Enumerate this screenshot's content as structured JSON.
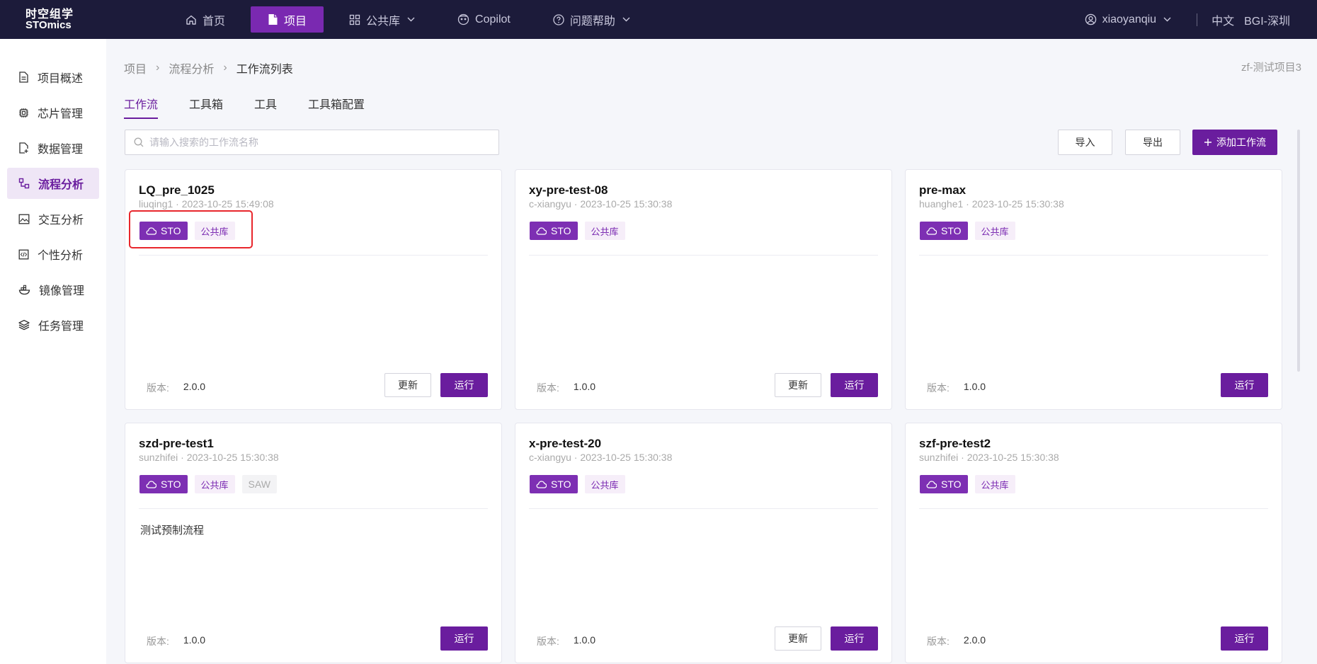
{
  "brand": {
    "line1": "时空组学",
    "line2": "STOmics"
  },
  "nav": [
    {
      "label": "首页",
      "icon": "home-icon",
      "active": false,
      "chevron": false
    },
    {
      "label": "项目",
      "icon": "file-icon",
      "active": true,
      "chevron": false
    },
    {
      "label": "公共库",
      "icon": "grid-icon",
      "active": false,
      "chevron": true
    },
    {
      "label": "Copilot",
      "icon": "copilot-icon",
      "active": false,
      "chevron": false
    },
    {
      "label": "问题帮助",
      "icon": "help-icon",
      "active": false,
      "chevron": true
    }
  ],
  "user": {
    "name": "xiaoyanqiu",
    "lang": "中文",
    "org": "BGI-深圳"
  },
  "sidebar": [
    {
      "label": "项目概述",
      "icon": "document-icon",
      "active": false
    },
    {
      "label": "芯片管理",
      "icon": "chip-icon",
      "active": false
    },
    {
      "label": "数据管理",
      "icon": "data-file-icon",
      "active": false
    },
    {
      "label": "流程分析",
      "icon": "flow-icon",
      "active": true
    },
    {
      "label": "交互分析",
      "icon": "image-chart-icon",
      "active": false
    },
    {
      "label": "个性分析",
      "icon": "code-box-icon",
      "active": false
    },
    {
      "label": "镜像管理",
      "icon": "container-icon",
      "active": false
    },
    {
      "label": "任务管理",
      "icon": "layers-icon",
      "active": false
    }
  ],
  "breadcrumb": [
    "项目",
    "流程分析",
    "工作流列表"
  ],
  "project_name": "zf-测试项目3",
  "tabs": [
    {
      "label": "工作流",
      "active": true
    },
    {
      "label": "工具箱",
      "active": false
    },
    {
      "label": "工具",
      "active": false
    },
    {
      "label": "工具箱配置",
      "active": false
    }
  ],
  "search": {
    "placeholder": "请输入搜索的工作流名称",
    "value": ""
  },
  "toolbar": {
    "import_label": "导入",
    "export_label": "导出",
    "add_label": "添加工作流"
  },
  "labels": {
    "version": "版本:",
    "update": "更新",
    "run": "运行"
  },
  "cards": [
    {
      "title": "LQ_pre_1025",
      "meta": "liuqing1 · 2023-10-25 15:49:08",
      "tags": [
        "STO",
        "公共库"
      ],
      "desc": "",
      "version": "2.0.0",
      "has_update": true
    },
    {
      "title": "xy-pre-test-08",
      "meta": "c-xiangyu · 2023-10-25 15:30:38",
      "tags": [
        "STO",
        "公共库"
      ],
      "desc": "",
      "version": "1.0.0",
      "has_update": true
    },
    {
      "title": "pre-max",
      "meta": "huanghe1 · 2023-10-25 15:30:38",
      "tags": [
        "STO",
        "公共库"
      ],
      "desc": "",
      "version": "1.0.0",
      "has_update": false
    },
    {
      "title": "szd-pre-test1",
      "meta": "sunzhifei · 2023-10-25 15:30:38",
      "tags": [
        "STO",
        "公共库",
        "SAW"
      ],
      "desc": "测试预制流程",
      "version": "1.0.0",
      "has_update": false
    },
    {
      "title": "x-pre-test-20",
      "meta": "c-xiangyu · 2023-10-25 15:30:38",
      "tags": [
        "STO",
        "公共库"
      ],
      "desc": "",
      "version": "1.0.0",
      "has_update": true
    },
    {
      "title": "szf-pre-test2",
      "meta": "sunzhifei · 2023-10-25 15:30:38",
      "tags": [
        "STO",
        "公共库"
      ],
      "desc": "",
      "version": "2.0.0",
      "has_update": false
    }
  ],
  "colors": {
    "topbar": "#1c1b3a",
    "accent": "#6a1d9e",
    "highlight": "#e8262c"
  }
}
